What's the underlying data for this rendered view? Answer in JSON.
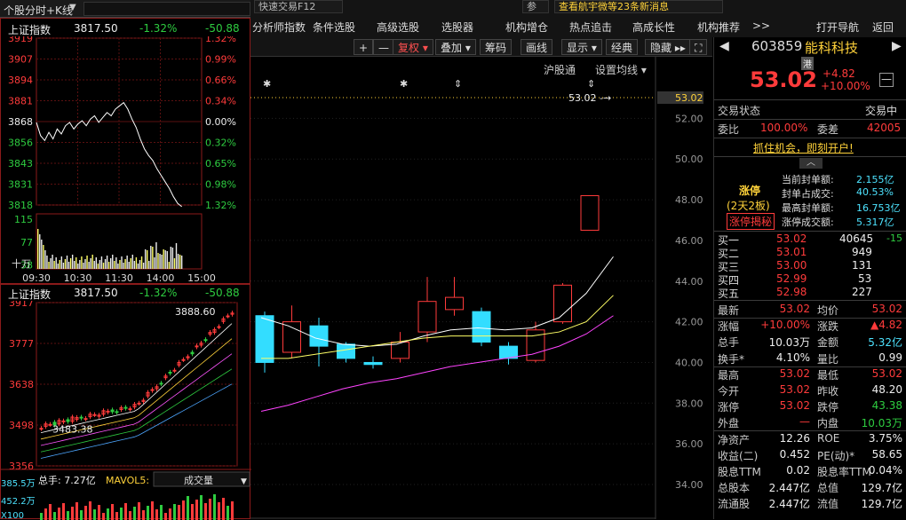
{
  "left_top": {
    "selector": "个股分时+K线",
    "dropdown": "▼"
  },
  "intraday": {
    "index_name": "上证指数",
    "value": "3817.50",
    "change": "-1.32%",
    "diff": "-50.88",
    "left_axis": [
      "3919",
      "3907",
      "3894",
      "3881",
      "3868",
      "3856",
      "3843",
      "3831",
      "3818"
    ],
    "right_axis": [
      "1.32%",
      "0.99%",
      "0.66%",
      "0.34%",
      "0.00%",
      "0.32%",
      "0.65%",
      "0.98%",
      "1.32%"
    ],
    "vol_axis": [
      "115",
      "77",
      "38",
      "十万"
    ],
    "time_labels": [
      "09:30",
      "10:30",
      "11:30",
      "14:00",
      "15:00"
    ],
    "price_series": [
      3868,
      3860,
      3857,
      3862,
      3858,
      3864,
      3861,
      3866,
      3868,
      3864,
      3867,
      3869,
      3866,
      3870,
      3872,
      3868,
      3871,
      3874,
      3872,
      3876,
      3878,
      3880,
      3876,
      3870,
      3865,
      3858,
      3852,
      3848,
      3845,
      3840,
      3836,
      3832,
      3828,
      3823,
      3819,
      3817
    ]
  },
  "kline": {
    "index_name": "上证指数",
    "value": "3817.50",
    "change": "-1.32%",
    "diff": "-50.88",
    "left_axis": [
      "3917",
      "3777",
      "3638",
      "3498",
      "3356"
    ],
    "high_label": "3888.60",
    "low_label": "3483.38",
    "vol_title": "总手: 7.27亿",
    "vol_ma": "MAVOL5:",
    "vol_select": "成交量",
    "vol_axis": [
      "385.5万",
      "452.2万",
      "X100"
    ]
  },
  "ticker": {
    "item1": "快速交易F12",
    "item2": "参",
    "item3": "查看航宇微等23条新消息"
  },
  "menu": [
    "分析师指数",
    "条件选股",
    "高级选股",
    "选股器",
    "机构增仓",
    "热点追击",
    "高成长性",
    "机构推荐",
    ">>",
    "打开导航",
    "返回"
  ],
  "toolbar": [
    "+",
    "—",
    "复权 ▾",
    "叠加 ▾",
    "筹码",
    "画线",
    "显示 ▾",
    "经典",
    "隐藏 ▸▸",
    "⛶"
  ],
  "chart_links": [
    "沪股通",
    "设置均线 ▾"
  ],
  "main_chart": {
    "y_ticks": [
      "53.02",
      "52.00",
      "50.00",
      "48.00",
      "46.00",
      "44.00",
      "42.00",
      "40.00",
      "38.00",
      "36.00",
      "34.00"
    ],
    "limit_line_label": "53.02 -→",
    "candles": [
      {
        "o": 42.3,
        "c": 40.0,
        "h": 42.5,
        "l": 39.5,
        "up": false
      },
      {
        "o": 40.5,
        "c": 42.0,
        "h": 42.8,
        "l": 40.2,
        "up": true
      },
      {
        "o": 41.8,
        "c": 40.8,
        "h": 42.2,
        "l": 39.8,
        "up": false
      },
      {
        "o": 40.9,
        "c": 40.2,
        "h": 41.0,
        "l": 40.0,
        "up": false
      },
      {
        "o": 40.0,
        "c": 39.9,
        "h": 40.3,
        "l": 39.7,
        "up": false
      },
      {
        "o": 40.2,
        "c": 41.0,
        "h": 41.5,
        "l": 40.0,
        "up": true
      },
      {
        "o": 41.5,
        "c": 43.0,
        "h": 44.2,
        "l": 41.0,
        "up": true
      },
      {
        "o": 42.6,
        "c": 43.2,
        "h": 44.2,
        "l": 42.3,
        "up": true
      },
      {
        "o": 42.5,
        "c": 41.0,
        "h": 42.7,
        "l": 40.8,
        "up": false
      },
      {
        "o": 40.8,
        "c": 40.2,
        "h": 41.0,
        "l": 39.9,
        "up": false
      },
      {
        "o": 40.1,
        "c": 41.6,
        "h": 42.0,
        "l": 40.0,
        "up": true
      },
      {
        "o": 42.0,
        "c": 43.8,
        "h": 43.9,
        "l": 41.9,
        "up": true
      },
      {
        "o": 46.5,
        "c": 48.2,
        "h": 48.2,
        "l": 46.5,
        "up": true
      }
    ],
    "ma1": [
      42.2,
      41.8,
      41.2,
      40.9,
      40.8,
      40.9,
      41.3,
      41.6,
      41.7,
      41.6,
      41.7,
      42.2,
      43.4,
      45.2
    ],
    "ma2": [
      40.2,
      40.2,
      40.4,
      40.6,
      40.8,
      41.0,
      41.2,
      41.3,
      41.3,
      41.3,
      41.3,
      41.5,
      42.0,
      43.3
    ],
    "ma3": [
      37.6,
      37.9,
      38.3,
      38.7,
      39.0,
      39.2,
      39.5,
      39.8,
      40.0,
      40.2,
      40.4,
      40.8,
      41.4,
      42.3
    ]
  },
  "quote": {
    "code": "603859",
    "name": "能科科技",
    "tag": "港",
    "price": "53.02",
    "chg": "+4.82",
    "pct": "+10.00%",
    "status_label": "交易状态",
    "status": "交易中",
    "weibi_label": "委比",
    "weibi": "100.00%",
    "weicha_label": "委差",
    "weicha": "42005",
    "banner": "抓住机会，即刻开户!",
    "limit": {
      "title": "涨停",
      "days": "(2天2板)",
      "secret": "涨停揭秘",
      "items": [
        [
          "当前封单额:",
          "2.155亿"
        ],
        [
          "封单占成交:",
          "40.53%"
        ],
        [
          "最高封单额:",
          "16.753亿"
        ],
        [
          "涨停成交额:",
          "5.317亿"
        ]
      ]
    },
    "bids": [
      [
        "买一",
        "53.02",
        "40645",
        "-15"
      ],
      [
        "买二",
        "53.01",
        "949",
        ""
      ],
      [
        "买三",
        "53.00",
        "131",
        ""
      ],
      [
        "买四",
        "52.99",
        "53",
        ""
      ],
      [
        "买五",
        "52.98",
        "227",
        ""
      ]
    ],
    "stats": [
      [
        "最新",
        "53.02",
        "均价",
        "53.02"
      ],
      [
        "涨幅",
        "+10.00%",
        "涨跌",
        "▲4.82"
      ],
      [
        "总手",
        "10.03万",
        "金额",
        "5.32亿"
      ],
      [
        "换手*",
        "4.10%",
        "量比",
        "0.99"
      ],
      [
        "最高",
        "53.02",
        "最低",
        "53.02"
      ],
      [
        "今开",
        "53.02",
        "昨收",
        "48.20"
      ],
      [
        "涨停",
        "53.02",
        "跌停",
        "43.38"
      ],
      [
        "外盘",
        "—",
        "内盘",
        "10.03万"
      ],
      [
        "净资产",
        "12.26",
        "ROE",
        "3.75%"
      ],
      [
        "收益(二)",
        "0.452",
        "PE(动)*",
        "58.65"
      ],
      [
        "股息TTM",
        "0.02",
        "股息率TTM",
        "0.04%"
      ],
      [
        "总股本",
        "2.447亿",
        "总值",
        "129.7亿"
      ],
      [
        "流通股",
        "2.447亿",
        "流值",
        "129.7亿"
      ]
    ]
  }
}
